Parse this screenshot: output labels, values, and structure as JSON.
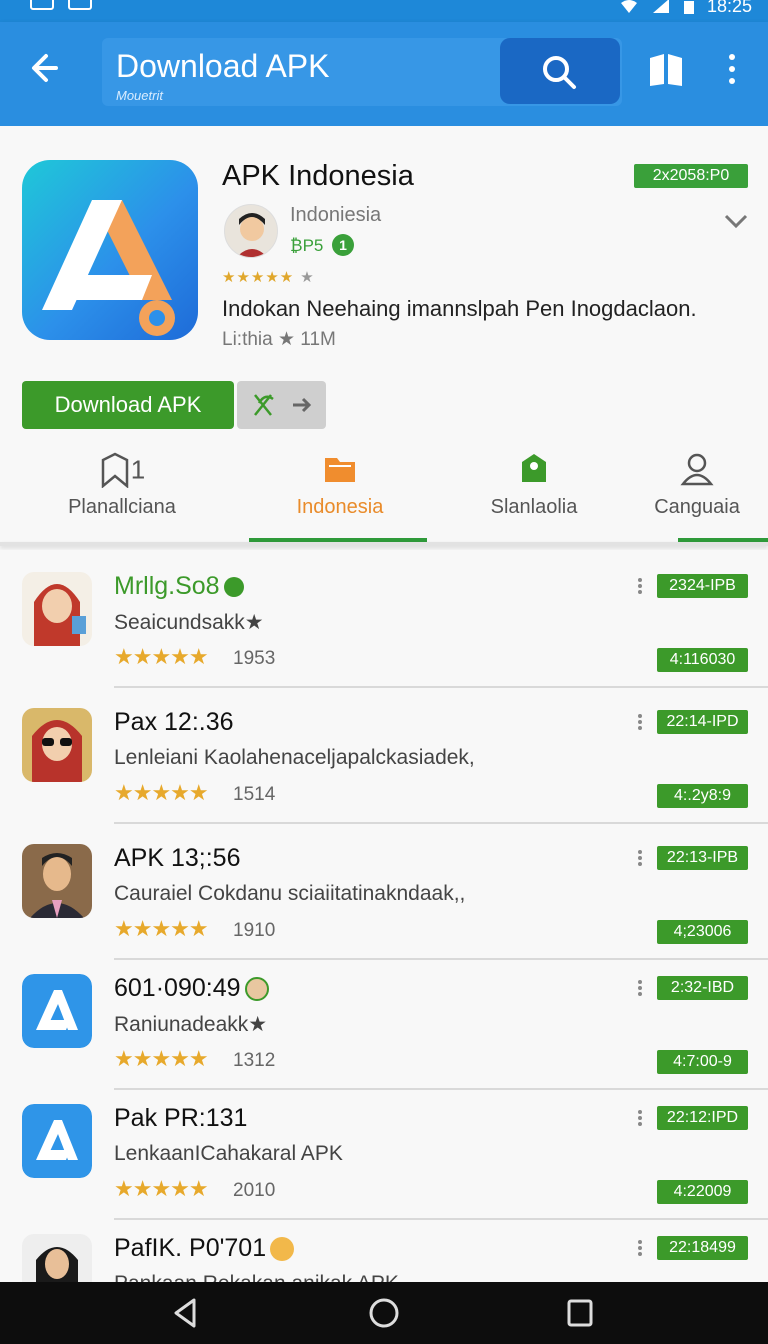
{
  "status_bar": {
    "time": "18:25"
  },
  "app_bar": {
    "title": "Download APK",
    "subtitle": "Mouetrit",
    "back_icon": "arrow-left-icon",
    "search_icon": "search-icon",
    "book_icon": "book-icon",
    "more_icon": "more-vert-icon"
  },
  "app": {
    "name": "APK Indonesia",
    "size_badge": "2x2058:P0",
    "developer": "Indoniesia",
    "developer_tag": "₿P5",
    "developer_badge": "1",
    "rating_stars": "★★★★★",
    "rating_extra": "★",
    "description": "Indokan Neehaing imannslpah Pen Inogdaclaon.",
    "meta": "Li:thia ★ 11M",
    "download_label": "Download APK",
    "accent_color": "#3c9a2a"
  },
  "tabs": [
    {
      "label": "Planallciana",
      "icon": "bookmark-icon",
      "count": "1"
    },
    {
      "label": "Indonesia",
      "icon": "folder-icon"
    },
    {
      "label": "Slanlaolia",
      "icon": "tag-icon"
    },
    {
      "label": "Canguaia",
      "icon": "person-icon"
    }
  ],
  "list": [
    {
      "title": "Mrllg.So8",
      "subtitle": "Seaicundsakk★",
      "stars": "★★★★★",
      "count": "1953",
      "badge_top": "2324-IPB",
      "badge_bottom": "4:116030",
      "icon": "hijab-avatar-icon"
    },
    {
      "title": "Pax 12:.36",
      "subtitle": "Lenleiani Kaolahenaceljapalckasiadek,",
      "stars": "★★★★★",
      "count": "1514",
      "badge_top": "22:14-IPD",
      "badge_bottom": "4:.2y8:9",
      "icon": "sunglasses-avatar-icon"
    },
    {
      "title": "APK 13;:56",
      "subtitle": "Cauraiel Cokdanu sciaiitatinakndaak,,",
      "stars": "★★★★★",
      "count": "1910",
      "badge_top": "22:13-IPB",
      "badge_bottom": "4;23006",
      "icon": "man-avatar-icon"
    },
    {
      "title": "601·090:49",
      "subtitle": "Raniunadeakk★",
      "stars": "★★★★★",
      "count": "1312",
      "badge_top": "2:32-IBD",
      "badge_bottom": "4:7:00-9",
      "icon": "apk-logo-icon"
    },
    {
      "title": "Pak PR:131",
      "subtitle": "LenkaanICahakaral APK",
      "stars": "★★★★★",
      "count": "2010",
      "badge_top": "22:12:IPD",
      "badge_bottom": "4:22009",
      "icon": "apk-logo-icon"
    },
    {
      "title": "PafIK. P0'701",
      "subtitle": "Pankaan Rekakan anikak APK",
      "stars": "★★★★★",
      "count": "",
      "badge_top": "22:18499",
      "badge_bottom": "",
      "icon": "woman-avatar-icon"
    }
  ],
  "nav": {
    "back": "nav-back-icon",
    "home": "nav-home-icon",
    "recents": "nav-recents-icon"
  }
}
